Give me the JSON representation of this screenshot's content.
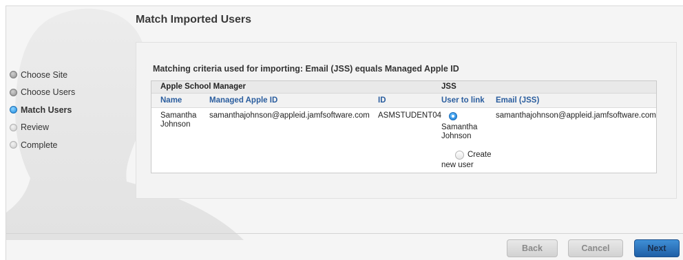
{
  "page": {
    "title": "Match Imported Users"
  },
  "steps": [
    {
      "label": "Choose Site",
      "state": "done"
    },
    {
      "label": "Choose Users",
      "state": "done"
    },
    {
      "label": "Match Users",
      "state": "current"
    },
    {
      "label": "Review",
      "state": "todo"
    },
    {
      "label": "Complete",
      "state": "todo"
    }
  ],
  "criteria": "Matching criteria used for importing: Email (JSS) equals Managed Apple ID",
  "table": {
    "group_headers": {
      "left": "Apple School Manager",
      "right": "JSS"
    },
    "columns": [
      "Name",
      "Managed Apple ID",
      "ID",
      "User to link",
      "Email (JSS)"
    ],
    "row": {
      "name_line1": "Samantha",
      "name_line2": "Johnson",
      "managed_apple_id": "samanthajohnson@appleid.jamfsoftware.com",
      "id": "ASMSTUDENT04",
      "link_option_1_line1": "Samantha",
      "link_option_1_line2": "Johnson",
      "link_option_2_line1": "Create",
      "link_option_2_line2": "new user",
      "link_selected": "Samantha Johnson",
      "email_jss": "samanthajohnson@appleid.jamfsoftware.com"
    }
  },
  "buttons": {
    "back": "Back",
    "cancel": "Cancel",
    "next": "Next"
  },
  "colors": {
    "accent": "#1a8be0",
    "header_text": "#2a5d9e",
    "primary_button": "#2d74bf"
  }
}
